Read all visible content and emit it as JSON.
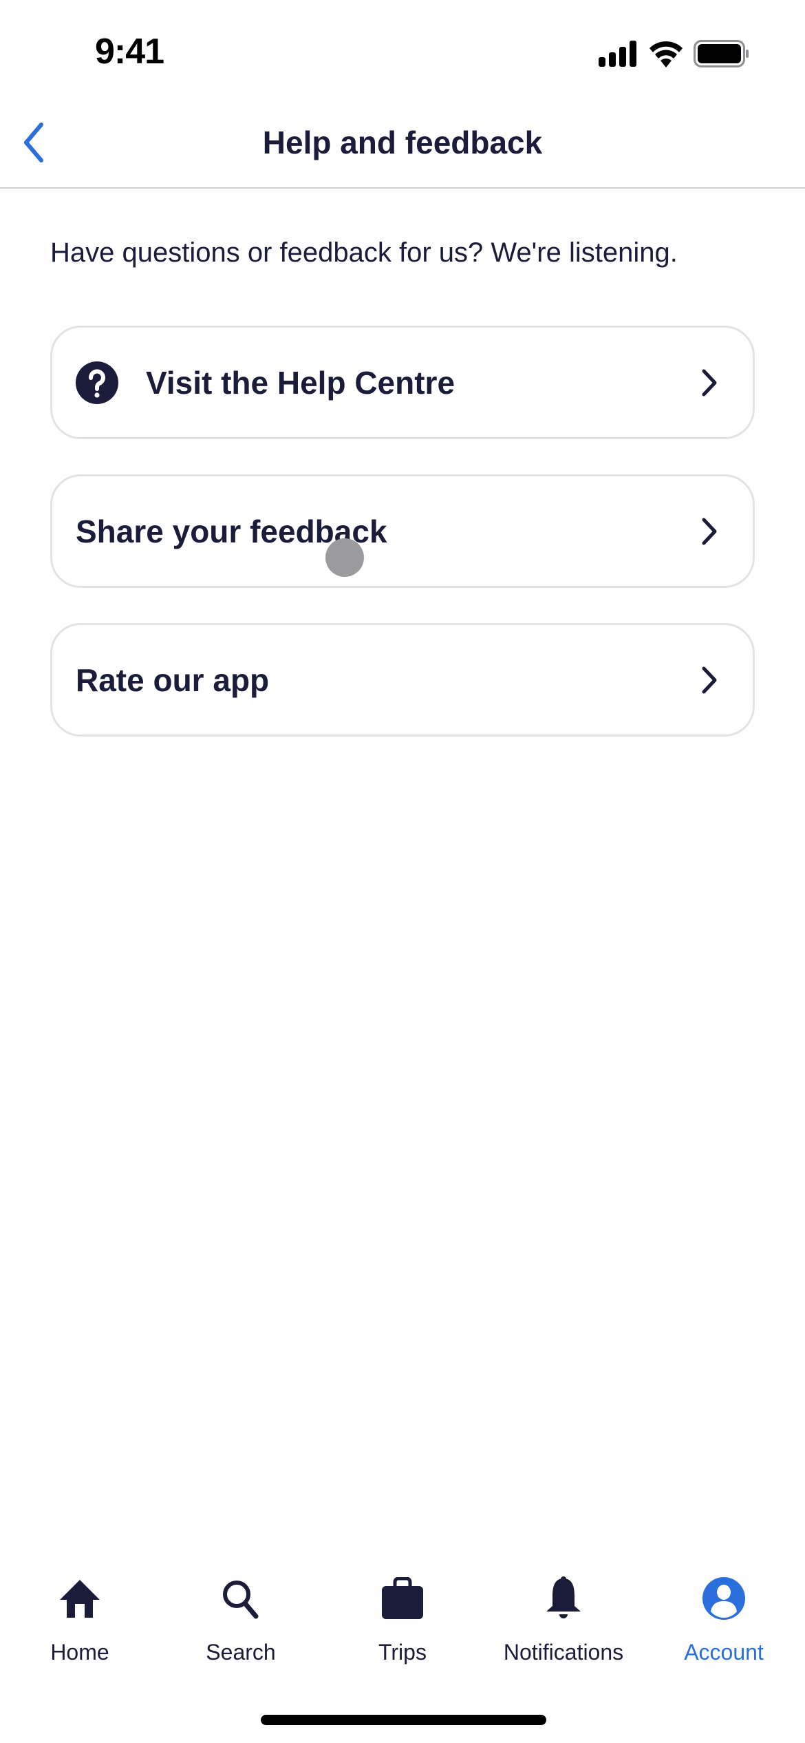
{
  "status_bar": {
    "time": "9:41"
  },
  "header": {
    "title": "Help and feedback",
    "back_icon": "chevron-left-icon"
  },
  "intro": "Have questions or feedback for us? We're listening.",
  "options": [
    {
      "label": "Visit the Help Centre",
      "icon": "question-circle-icon"
    },
    {
      "label": "Share your feedback"
    },
    {
      "label": "Rate our app"
    }
  ],
  "tab_bar": {
    "tabs": [
      {
        "label": "Home",
        "icon": "home-icon",
        "active": false
      },
      {
        "label": "Search",
        "icon": "search-icon",
        "active": false
      },
      {
        "label": "Trips",
        "icon": "suitcase-icon",
        "active": false
      },
      {
        "label": "Notifications",
        "icon": "bell-icon",
        "active": false
      },
      {
        "label": "Account",
        "icon": "account-icon",
        "active": true
      }
    ]
  },
  "colors": {
    "text": "#1b1b3a",
    "accent": "#2a6fdb",
    "card_border": "#e3e3e6",
    "divider": "#cfcfd4"
  }
}
